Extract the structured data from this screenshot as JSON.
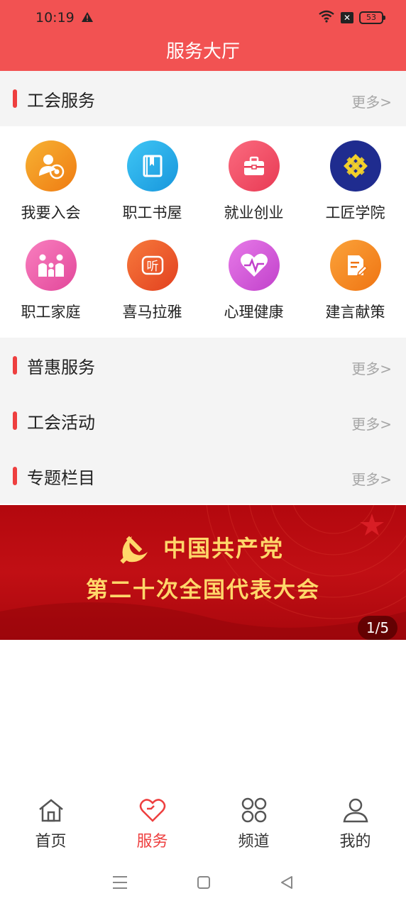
{
  "status": {
    "time": "10:19",
    "battery": "53"
  },
  "header": {
    "title": "服务大厅"
  },
  "sections": [
    {
      "title": "工会服务",
      "more": "更多>"
    },
    {
      "title": "普惠服务",
      "more": "更多>"
    },
    {
      "title": "工会活动",
      "more": "更多>"
    },
    {
      "title": "专题栏目",
      "more": "更多>"
    }
  ],
  "services": [
    {
      "label": "我要入会",
      "icon": "member-icon",
      "color": "#f39a1c"
    },
    {
      "label": "职工书屋",
      "icon": "book-icon",
      "color": "#22aee9"
    },
    {
      "label": "就业创业",
      "icon": "briefcase-icon",
      "color": "#f2546a"
    },
    {
      "label": "工匠学院",
      "icon": "academy-logo-icon",
      "color": "#1f2c8f"
    },
    {
      "label": "职工家庭",
      "icon": "family-icon",
      "color": "#ee5aa8"
    },
    {
      "label": "喜马拉雅",
      "icon": "ximalaya-icon",
      "color": "#f05a2c"
    },
    {
      "label": "心理健康",
      "icon": "heart-pulse-icon",
      "color": "#d656dc"
    },
    {
      "label": "建言献策",
      "icon": "suggestion-icon",
      "color": "#f58a1e"
    }
  ],
  "banner": {
    "line1": "中国共产党",
    "line2": "第二十次全国代表大会",
    "pager": "1/5"
  },
  "tabs": [
    {
      "label": "首页",
      "icon": "home-icon",
      "active": false
    },
    {
      "label": "服务",
      "icon": "heart-icon",
      "active": true
    },
    {
      "label": "频道",
      "icon": "channels-icon",
      "active": false
    },
    {
      "label": "我的",
      "icon": "profile-icon",
      "active": false
    }
  ]
}
